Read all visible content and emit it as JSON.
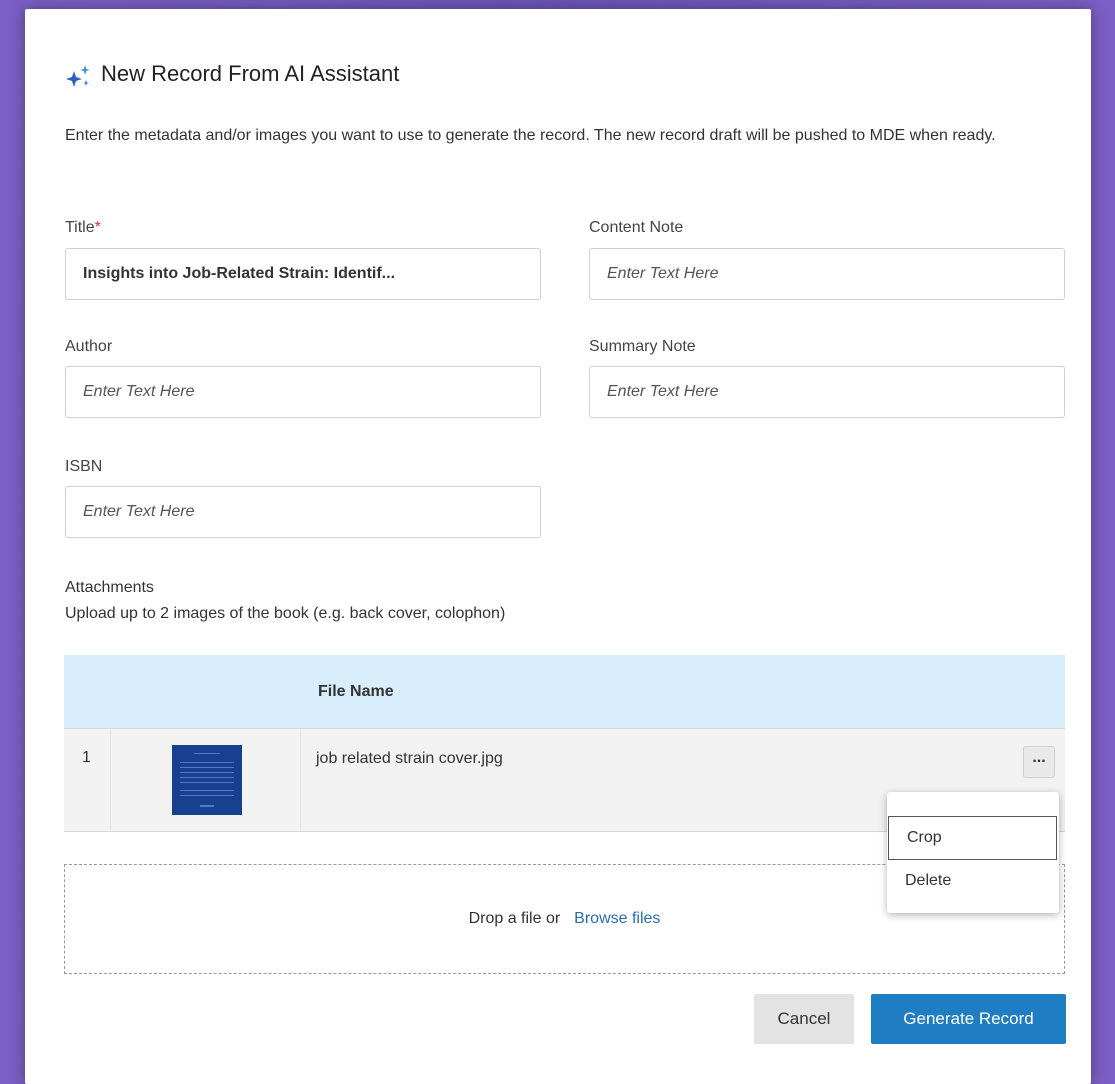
{
  "dialog": {
    "title": "New Record From AI Assistant",
    "intro": "Enter the metadata and/or images you want to use to generate the record. The new record draft will be pushed to MDE when ready."
  },
  "fields": {
    "title": {
      "label": "Title",
      "required_mark": "*",
      "value": "Insights into Job-Related Strain: Identif..."
    },
    "content_note": {
      "label": "Content Note",
      "placeholder": "Enter Text Here"
    },
    "author": {
      "label": "Author",
      "placeholder": "Enter Text Here"
    },
    "summary_note": {
      "label": "Summary Note",
      "placeholder": "Enter Text Here"
    },
    "isbn": {
      "label": "ISBN",
      "placeholder": "Enter Text Here"
    }
  },
  "attachments": {
    "label": "Attachments",
    "hint": "Upload up to 2 images of the book (e.g. back cover, colophon)",
    "column_file_name": "File Name",
    "rows": [
      {
        "index": "1",
        "file_name": "job related strain cover.jpg",
        "more_label": "..."
      }
    ],
    "dropzone_text": "Drop a file or",
    "browse_label": "Browse files"
  },
  "row_menu": {
    "items": [
      {
        "label": "Crop"
      },
      {
        "label": "Delete"
      }
    ]
  },
  "buttons": {
    "cancel": "Cancel",
    "generate": "Generate Record"
  },
  "colors": {
    "primary": "#1f7ec3",
    "table_header": "#d8eefc",
    "required": "#d9312b",
    "sparkle": "#1e6fd6"
  }
}
